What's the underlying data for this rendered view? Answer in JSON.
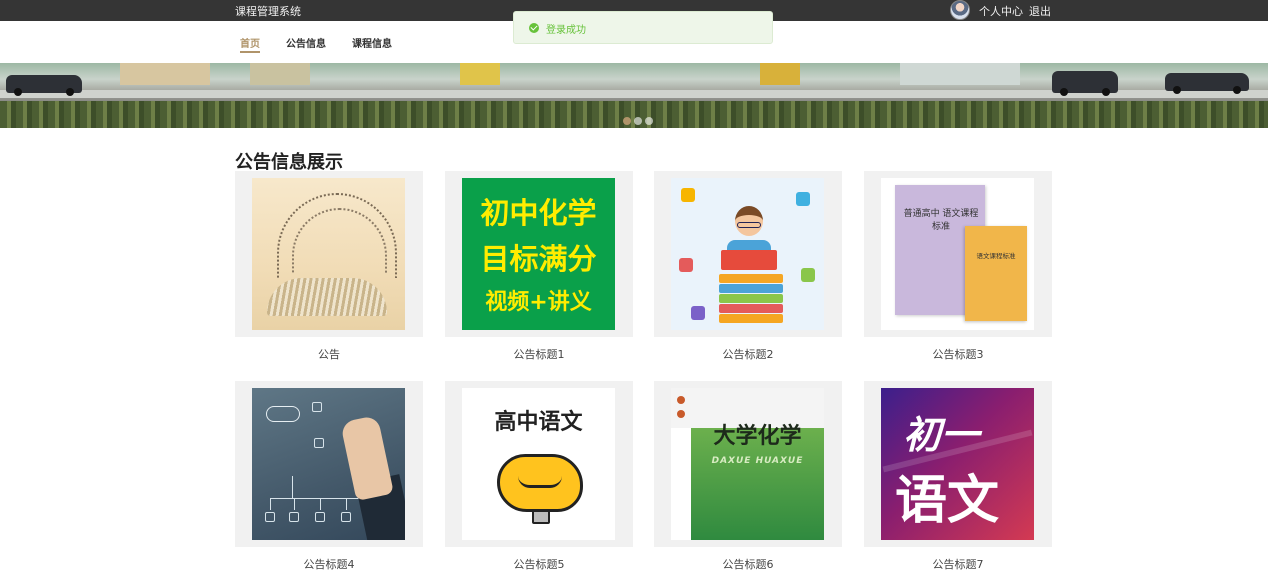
{
  "header": {
    "app_title": "课程管理系统",
    "user_center": "个人中心",
    "logout": "退出"
  },
  "nav": {
    "items": [
      {
        "label": "首页",
        "active": true
      },
      {
        "label": "公告信息",
        "active": false
      },
      {
        "label": "课程信息",
        "active": false
      }
    ]
  },
  "toast": {
    "message": "登录成功",
    "type": "success",
    "color": "#67c23a"
  },
  "banner": {
    "slide_count": 3,
    "active_slide": 1
  },
  "section": {
    "title": "公告信息展示"
  },
  "cards": [
    {
      "caption": "公告"
    },
    {
      "caption": "公告标题1",
      "art": {
        "lines": [
          "初中化学",
          "目标满分",
          "视频+讲义"
        ]
      }
    },
    {
      "caption": "公告标题2"
    },
    {
      "caption": "公告标题3",
      "art": {
        "cover_main": "普通高中 语文课程标准",
        "cover_small": "语文课程标准"
      }
    },
    {
      "caption": "公告标题4"
    },
    {
      "caption": "公告标题5",
      "art": {
        "title": "高中语文"
      }
    },
    {
      "caption": "公告标题6",
      "art": {
        "title": "大学化学",
        "pinyin": "DAXUE HUAXUE"
      }
    },
    {
      "caption": "公告标题7",
      "art": {
        "line1": "初一",
        "line2": "语文"
      }
    }
  ],
  "colors": {
    "topbar": "#353535",
    "accent": "#b0946a",
    "card_bg": "#f1f1f1"
  }
}
